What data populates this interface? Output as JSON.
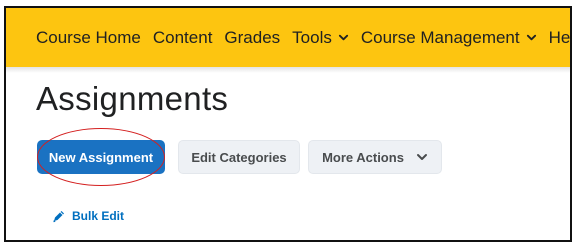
{
  "nav": {
    "items": [
      {
        "label": "Course Home",
        "dropdown": false
      },
      {
        "label": "Content",
        "dropdown": false
      },
      {
        "label": "Grades",
        "dropdown": false
      },
      {
        "label": "Tools",
        "dropdown": true
      },
      {
        "label": "Course Management",
        "dropdown": true
      },
      {
        "label": "Help",
        "dropdown": true
      }
    ],
    "background_color": "#fdc510"
  },
  "page": {
    "title": "Assignments"
  },
  "toolbar": {
    "new_label": "New Assignment",
    "edit_categories_label": "Edit Categories",
    "more_actions_label": "More Actions",
    "primary_color": "#1a72c2"
  },
  "bulk_edit": {
    "label": "Bulk Edit",
    "icon": "pencil-icon"
  },
  "annotation": {
    "ring_color": "#d42020"
  }
}
